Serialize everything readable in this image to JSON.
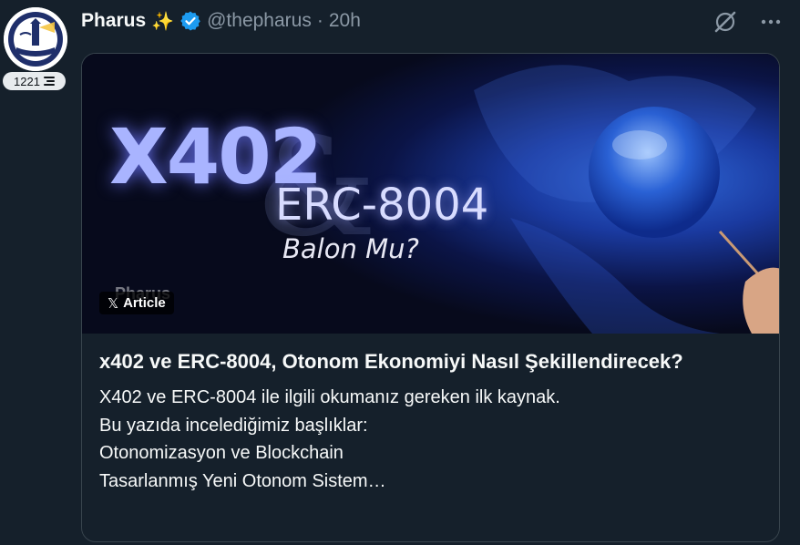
{
  "author": {
    "display_name": "Pharus",
    "emoji": "✨",
    "handle": "@thepharus",
    "separator": "·",
    "timestamp": "20h",
    "verified": true
  },
  "badge": {
    "count": "1221"
  },
  "card": {
    "image": {
      "headline": "X402",
      "ampersand": "&",
      "subheadline": "ERC-8004",
      "tagline": "Balon Mu?",
      "watermark": "Pharus"
    },
    "type_label": "Article",
    "title": "x402 ve ERC-8004, Otonom Ekonomiyi Nasıl Şekillendirecek?",
    "description_lines": [
      "X402 ve ERC-8004 ile ilgili okumanız gereken ilk kaynak.",
      "Bu yazıda incelediğimiz başlıklar:",
      "Otonomizasyon ve Blockchain",
      "Tasarlanmış Yeni Otonom Sistem…"
    ]
  },
  "icons": {
    "grok": "grok-icon",
    "more": "more-icon",
    "verified": "verified-badge-icon",
    "x_logo": "x-logo-icon"
  },
  "colors": {
    "background": "#15202b",
    "border": "#38444d",
    "secondary_text": "#8b98a5",
    "verified_blue": "#1d9bf0"
  }
}
